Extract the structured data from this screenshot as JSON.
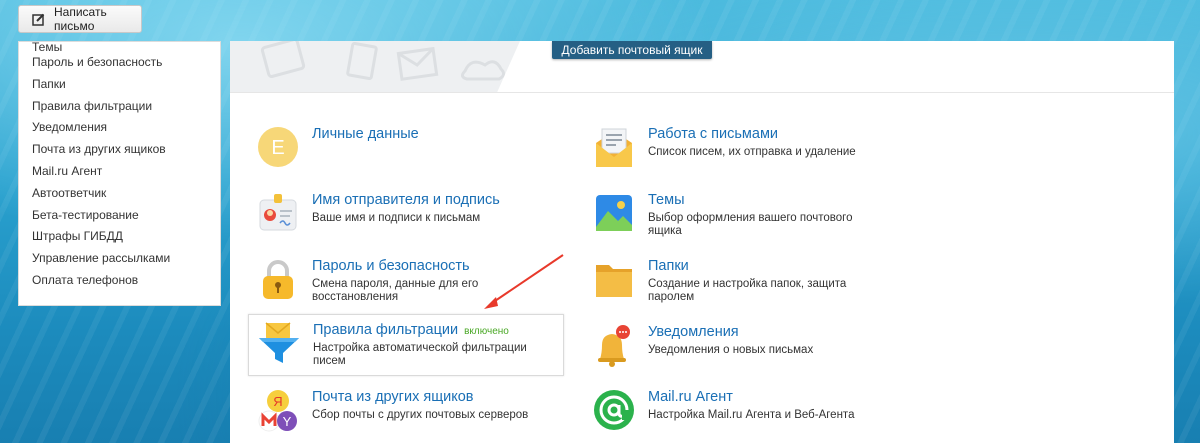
{
  "toolbar": {
    "compose_label": "Написать письмо"
  },
  "sidebar": {
    "items": [
      {
        "label": "Темы"
      },
      {
        "label": "Пароль и безопасность"
      },
      {
        "label": "Папки"
      },
      {
        "label": "Правила фильтрации"
      },
      {
        "label": "Уведомления"
      },
      {
        "label": "Почта из других ящиков"
      },
      {
        "label": "Mail.ru Агент"
      },
      {
        "label": "Автоответчик"
      },
      {
        "label": "Бета-тестирование"
      },
      {
        "label": "Штрафы ГИБДД"
      },
      {
        "label": "Управление рассылками"
      },
      {
        "label": "Оплата телефонов"
      }
    ]
  },
  "header": {
    "add_mailbox_label": "Добавить почтовый ящик"
  },
  "settings": {
    "personal": {
      "title": "Личные данные",
      "desc": "",
      "icon": "personal-data-icon",
      "letter": "E"
    },
    "sender": {
      "title": "Имя отправителя и подпись",
      "desc": "Ваше имя и подписи к письмам",
      "icon": "signature-card-icon"
    },
    "password": {
      "title": "Пароль и безопасность",
      "desc": "Смена пароля, данные для его восстановления",
      "icon": "padlock-icon"
    },
    "filters": {
      "title": "Правила фильтрации",
      "badge": "включено",
      "desc": "Настройка автоматической фильтрации писем",
      "icon": "filter-funnel-icon"
    },
    "collector": {
      "title": "Почта из других ящиков",
      "desc": "Сбор почты с других почтовых серверов",
      "icon": "mail-collector-icon"
    },
    "letters": {
      "title": "Работа с письмами",
      "desc": "Список писем, их отправка и удаление",
      "icon": "open-envelope-icon"
    },
    "themes": {
      "title": "Темы",
      "desc": "Выбор оформления вашего почтового ящика",
      "icon": "picture-icon"
    },
    "folders": {
      "title": "Папки",
      "desc": "Создание и настройка папок, защита паролем",
      "icon": "folder-icon"
    },
    "notifications": {
      "title": "Уведомления",
      "desc": "Уведомления о новых письмах",
      "icon": "bell-icon"
    },
    "agent": {
      "title": "Mail.ru Агент",
      "desc": "Настройка Mail.ru Агента и Веб-Агента",
      "icon": "agent-at-icon"
    }
  },
  "colors": {
    "link": "#1a6fb5",
    "badge": "#4aa826",
    "annotation_arrow": "#e8392b",
    "header_button": "#255f84"
  }
}
